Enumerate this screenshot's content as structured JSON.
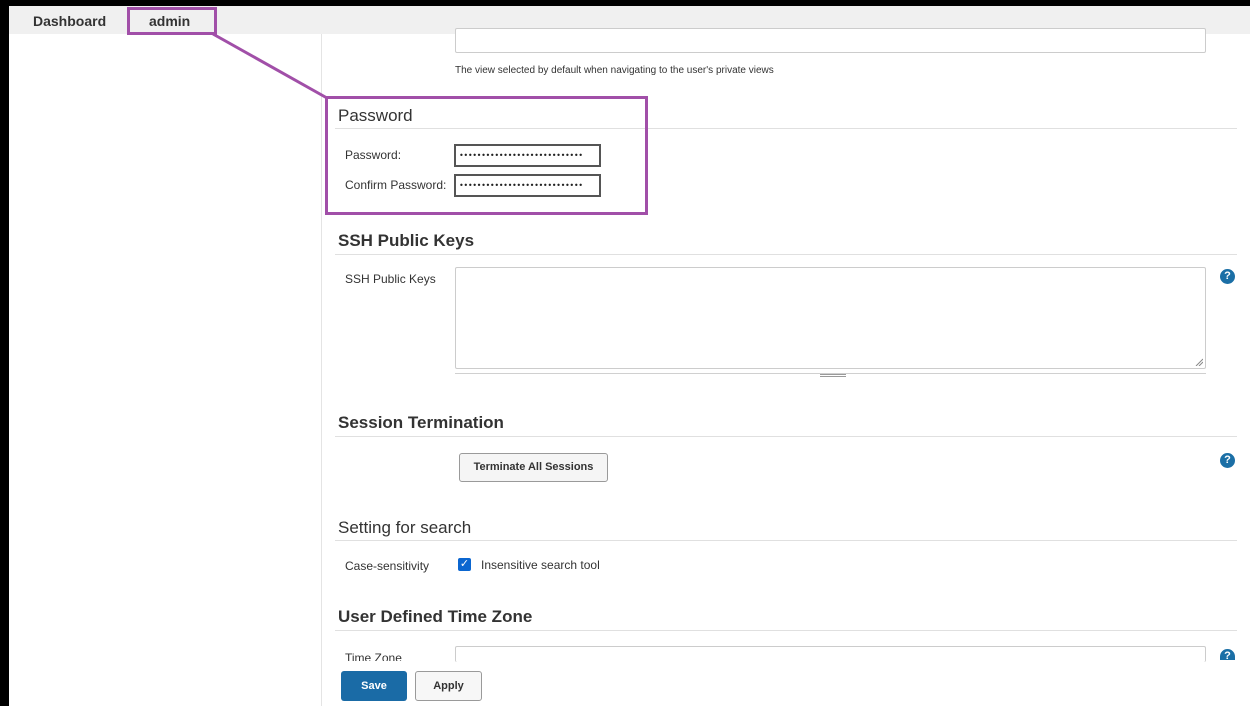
{
  "breadcrumb": {
    "items": [
      "Dashboard",
      "admin"
    ]
  },
  "default_view": {
    "help_text": "The view selected by default when navigating to the user's private views"
  },
  "password_section": {
    "title": "Password",
    "password_label": "Password:",
    "confirm_label": "Confirm Password:",
    "password_value": "••••••••••••••••••••••••••••",
    "confirm_value": "••••••••••••••••••••••••••••"
  },
  "ssh_section": {
    "title": "SSH Public Keys",
    "field_label": "SSH Public Keys",
    "value": ""
  },
  "session_section": {
    "title": "Session Termination",
    "button_label": "Terminate All Sessions"
  },
  "search_section": {
    "title": "Setting for search",
    "field_label": "Case-sensitivity",
    "checkbox_label": "Insensitive search tool",
    "checked": true
  },
  "timezone_section": {
    "title": "User Defined Time Zone",
    "field_label": "Time Zone"
  },
  "actions": {
    "save_label": "Save",
    "apply_label": "Apply"
  },
  "icons": {
    "help": "help-circle-icon",
    "checkbox": "checkbox-checked-icon"
  },
  "colors": {
    "primary_button": "#1a6ba6",
    "help_icon": "#1b6fa6",
    "checkbox": "#0b66d0",
    "annotation_highlight": "#a14fa8"
  }
}
